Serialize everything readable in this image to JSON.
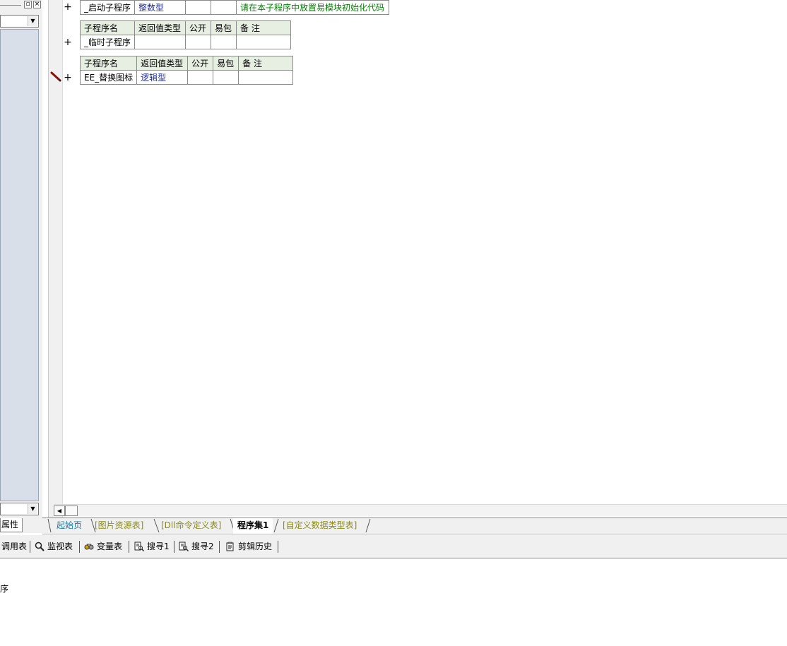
{
  "left_panel": {
    "tab_label": "属性"
  },
  "subroutines": [
    {
      "header": null,
      "name": "_启动子程序",
      "return_type": "整数型",
      "public": "",
      "easy_pack": "",
      "comment": "请在本子程序中放置易模块初始化代码"
    },
    {
      "header": {
        "name": "子程序名",
        "return_type": "返回值类型",
        "public": "公开",
        "easy_pack": "易包",
        "comment": "备 注"
      },
      "name": "_临时子程序",
      "return_type": "",
      "public": "",
      "easy_pack": "",
      "comment": ""
    },
    {
      "header": {
        "name": "子程序名",
        "return_type": "返回值类型",
        "public": "公开",
        "easy_pack": "易包",
        "comment": "备 注"
      },
      "name": "EE_替换图标",
      "return_type": "逻辑型",
      "public": "",
      "easy_pack": "",
      "comment": ""
    }
  ],
  "doc_tabs": [
    {
      "label": "起始页",
      "color": "#1f7aa5",
      "active": false
    },
    {
      "label": "[图片资源表]",
      "color": "#8a8a1a",
      "active": false
    },
    {
      "label": "[Dll命令定义表]",
      "color": "#8a8a1a",
      "active": false
    },
    {
      "label": "程序集1",
      "color": "#000000",
      "active": true
    },
    {
      "label": "[自定义数据类型表]",
      "color": "#8a8a1a",
      "active": false
    }
  ],
  "bottom_toolbar": [
    {
      "label": "调用表",
      "icon": "call-table-icon"
    },
    {
      "label": "监视表",
      "icon": "magnifier-icon"
    },
    {
      "label": "变量表",
      "icon": "variables-icon"
    },
    {
      "label": "搜寻1",
      "icon": "search-doc-icon"
    },
    {
      "label": "搜寻2",
      "icon": "search-doc-icon"
    },
    {
      "label": "剪辑历史",
      "icon": "clipboard-icon"
    }
  ],
  "output": {
    "text": "序"
  }
}
